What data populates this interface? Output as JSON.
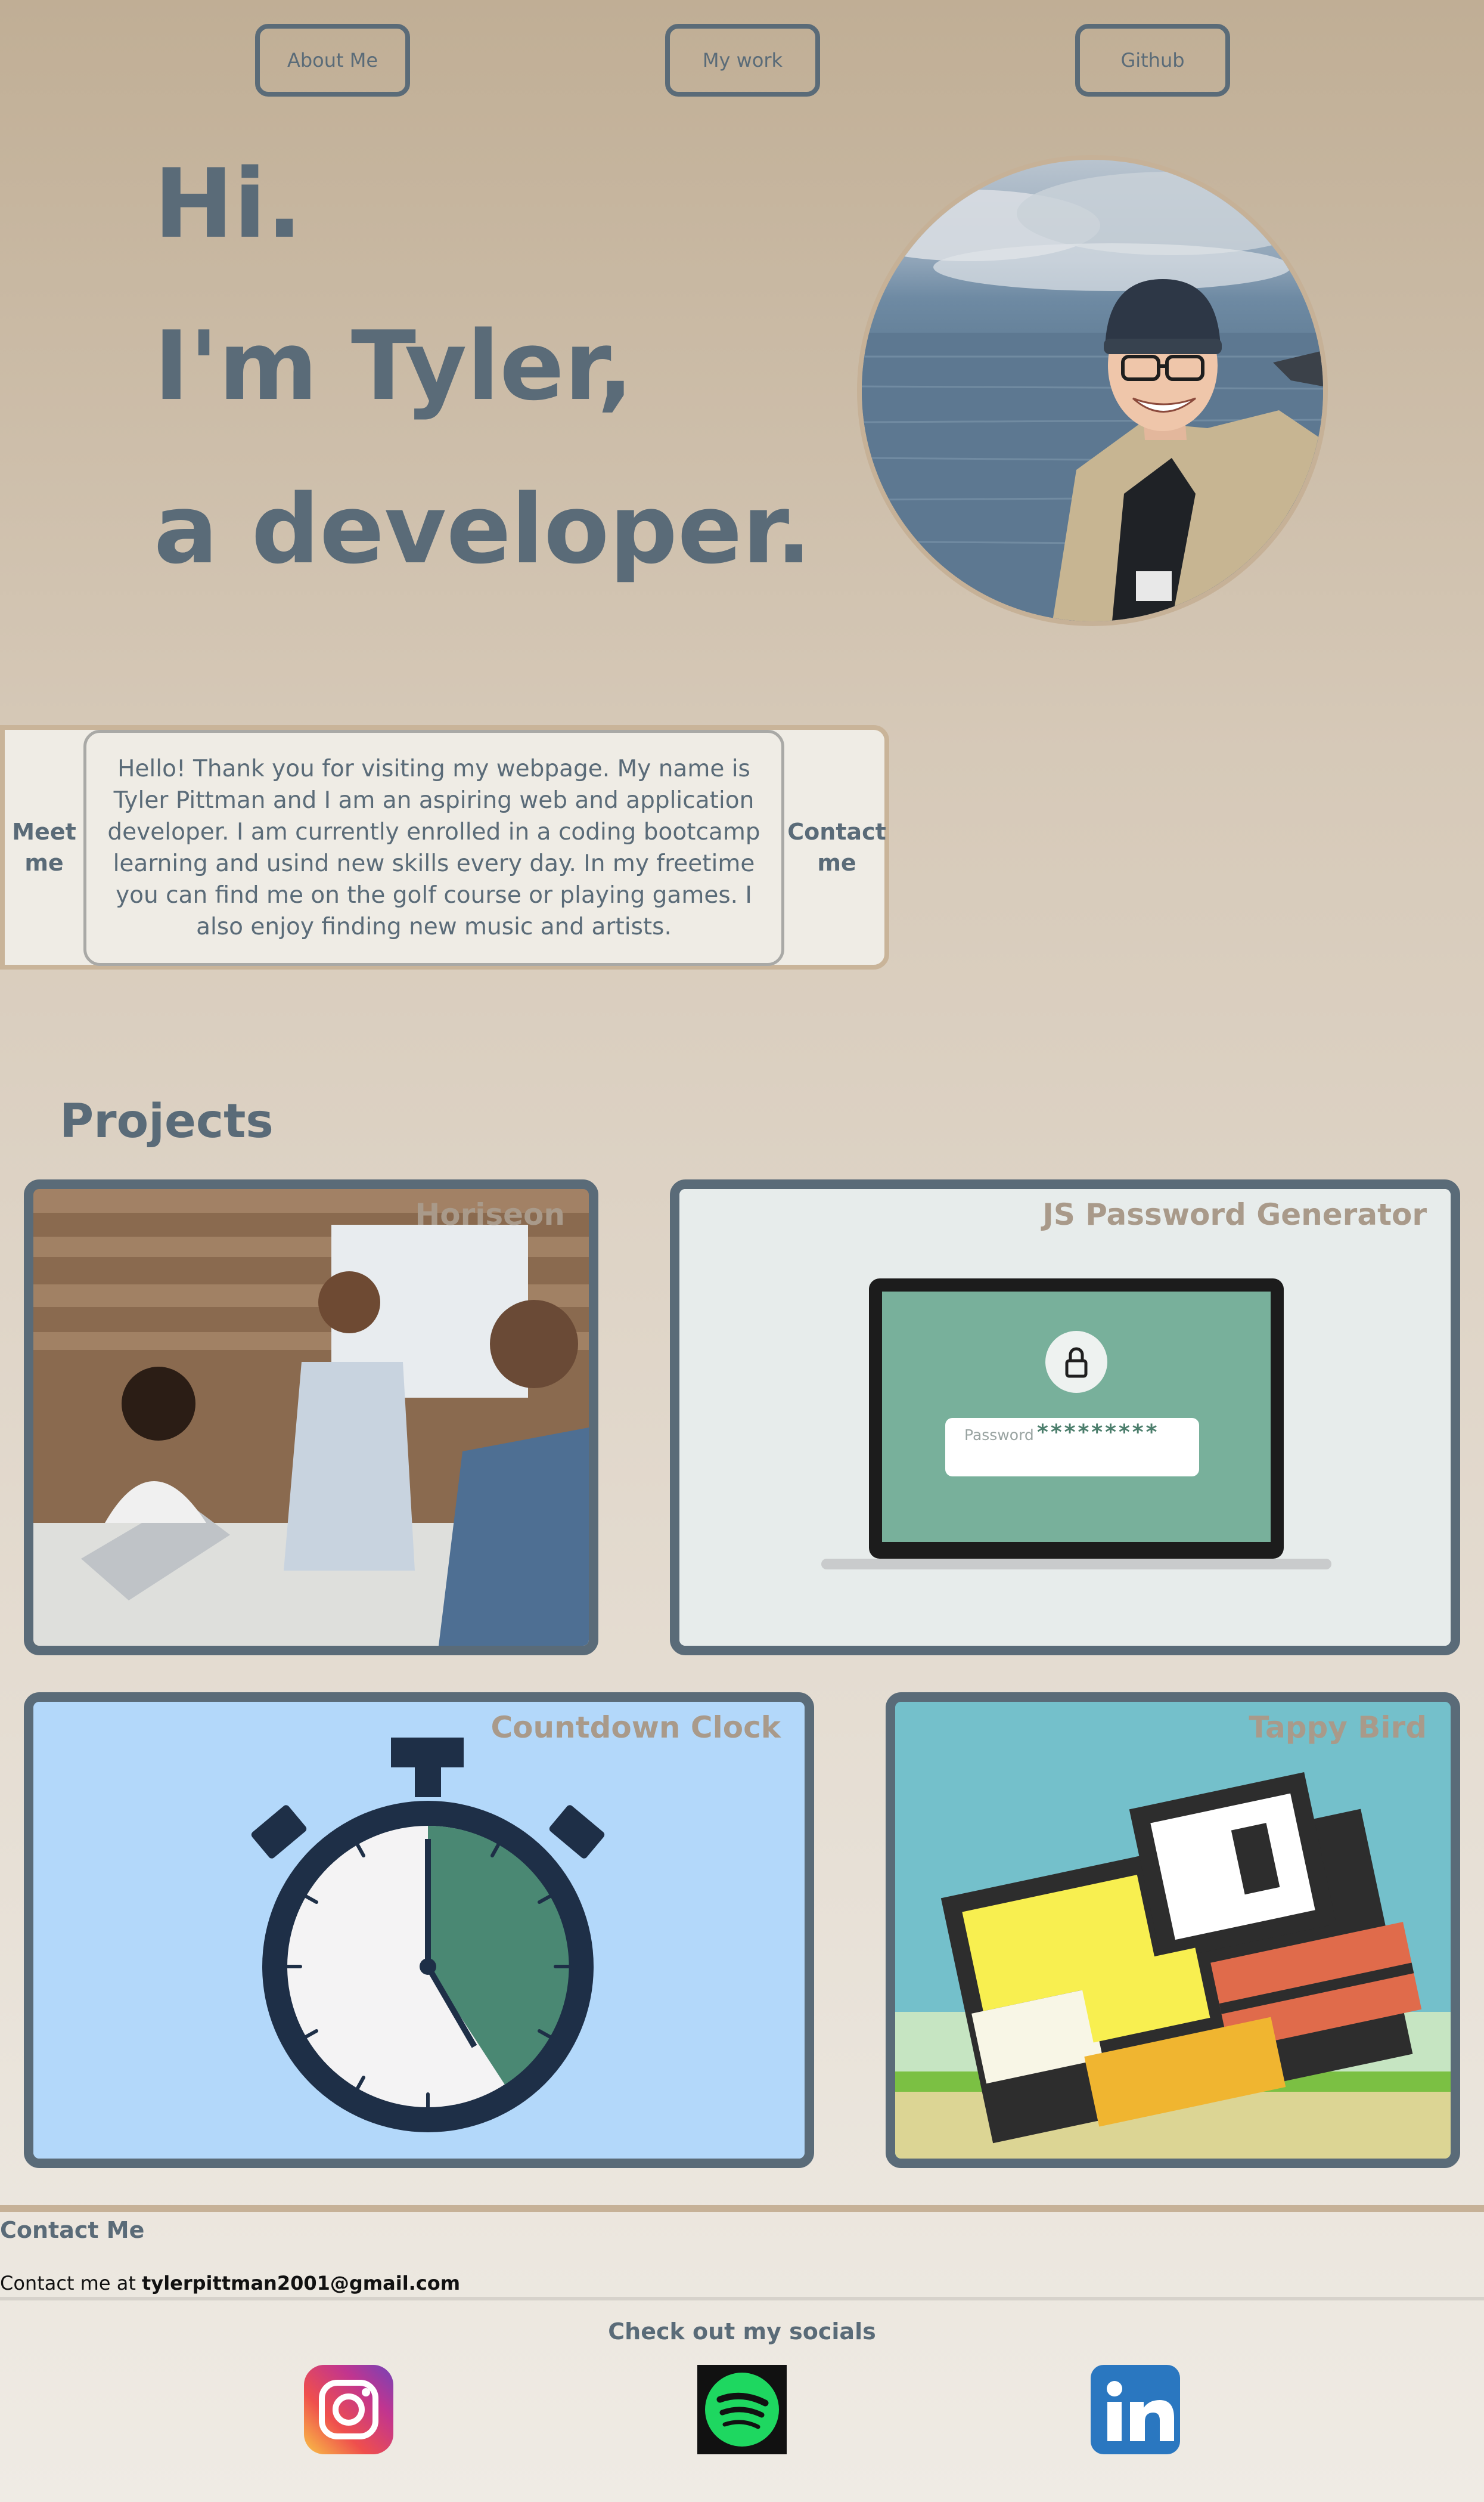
{
  "nav": {
    "items": [
      {
        "label": "About Me"
      },
      {
        "label": "My work"
      },
      {
        "label": "Github"
      }
    ]
  },
  "hero": {
    "line1": "Hi.",
    "line2": "I'm Tyler,",
    "line3": "a developer."
  },
  "about": {
    "left_label": "Meet me",
    "text": "Hello! Thank you for visiting my webpage. My name is Tyler Pittman and I am an aspiring web and application developer. I am currently enrolled in a coding bootcamp learning and usind new skills every day. In my freetime you can find me on the golf course or playing games. I also enjoy finding new music and artists.",
    "right_label": "Contact me"
  },
  "projects": {
    "title": "Projects",
    "items": [
      {
        "title": "Horiseon"
      },
      {
        "title": "JS Password Generator",
        "password_label": "Password",
        "password_mask": "*********"
      },
      {
        "title": "Countdown Clock"
      },
      {
        "title": "Tappy Bird"
      }
    ]
  },
  "contact": {
    "heading": "Contact Me",
    "prefix": "Contact me at ",
    "email": "tylerpittman2001@gmail.com"
  },
  "socials": {
    "heading": "Check out my socials",
    "items": [
      {
        "name": "instagram-icon"
      },
      {
        "name": "spotify-icon"
      },
      {
        "name": "linkedin-icon"
      }
    ]
  },
  "colors": {
    "accent": "#5a6b78",
    "tan": "#c6b197",
    "card_title": "#a99a8a"
  }
}
